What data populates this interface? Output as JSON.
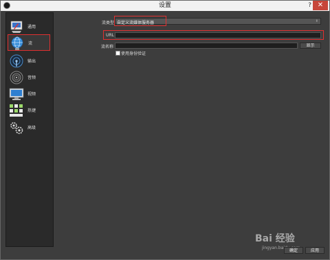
{
  "window": {
    "title": "设置",
    "help_label": "?",
    "close_label": "✕"
  },
  "sidebar": {
    "items": [
      {
        "label": "通用",
        "icon": "general-icon"
      },
      {
        "label": "流",
        "icon": "stream-globe-icon",
        "active": true
      },
      {
        "label": "输出",
        "icon": "output-icon"
      },
      {
        "label": "音频",
        "icon": "audio-icon"
      },
      {
        "label": "视频",
        "icon": "video-icon"
      },
      {
        "label": "热键",
        "icon": "hotkeys-icon"
      },
      {
        "label": "高级",
        "icon": "advanced-gears-icon"
      }
    ]
  },
  "stream": {
    "type_label": "流类型",
    "type_value": "自定义流媒体服务器",
    "url_label": "URL",
    "url_value": "",
    "key_label": "流名称",
    "key_value": "",
    "show_button": "显示",
    "auth_label": "使用身份验证",
    "auth_checked": false
  },
  "watermark": {
    "brand": "Bai 经验",
    "url": "jingyan.baidu.com"
  },
  "footer": {
    "ok_label": "确定",
    "apply_label": "应用"
  },
  "colors": {
    "highlight": "#e23030",
    "background": "#3d3d3d",
    "sidebar": "#2a2a2a"
  }
}
